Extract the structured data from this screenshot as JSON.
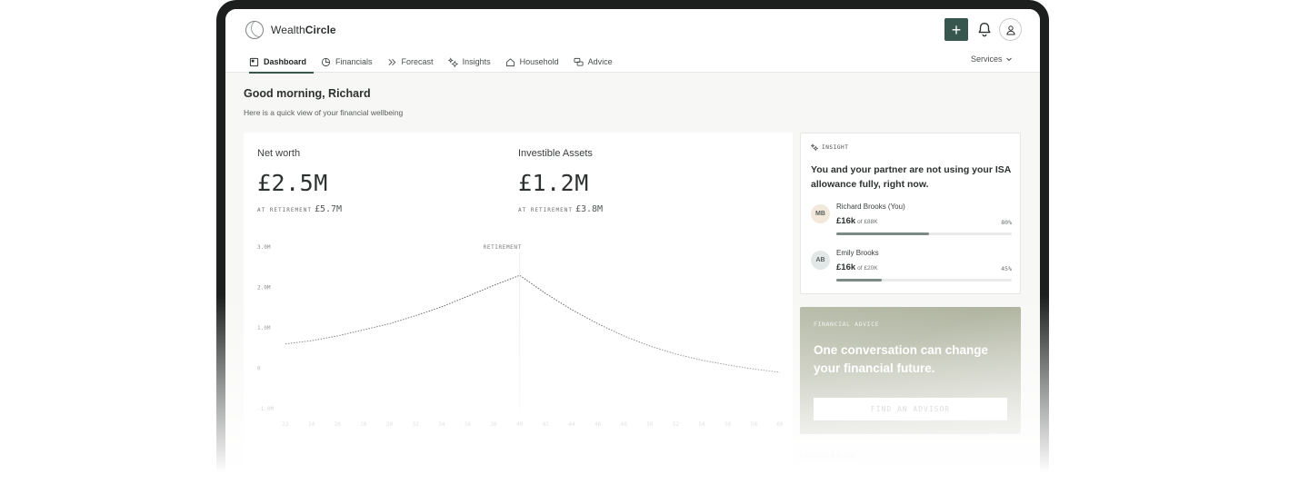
{
  "app": {
    "brand_prefix": "Wealth",
    "brand_suffix": "Circle"
  },
  "header": {
    "plus_label": "+",
    "services_label": "Services"
  },
  "nav": {
    "items": [
      {
        "label": "Dashboard",
        "icon": "dashboard-icon",
        "active": true
      },
      {
        "label": "Financials",
        "icon": "pie-chart-icon"
      },
      {
        "label": "Forecast",
        "icon": "chevrons-right-icon"
      },
      {
        "label": "Insights",
        "icon": "sparkle-icon"
      },
      {
        "label": "Household",
        "icon": "home-icon"
      },
      {
        "label": "Advice",
        "icon": "chat-icon"
      }
    ]
  },
  "greeting": {
    "title": "Good morning, Richard",
    "subtitle": "Here is a quick view of your financial wellbeing"
  },
  "metrics": {
    "net_worth": {
      "label": "Net worth",
      "value": "£2.5M",
      "ret_caption": "AT RETIREMENT",
      "ret_value": "£5.7M"
    },
    "investable": {
      "label": "Investible Assets",
      "value": "£1.2M",
      "ret_caption": "AT RETIREMENT",
      "ret_value": "£3.8M"
    }
  },
  "chart_data": {
    "type": "line",
    "ylabels": [
      "3.0M",
      "2.0M",
      "1.0M",
      "0",
      "-1.0M"
    ],
    "yvalues": [
      3.0,
      2.0,
      1.0,
      0,
      -1.0
    ],
    "ylim": [
      -1.0,
      3.0
    ],
    "x": [
      22,
      24,
      26,
      28,
      30,
      32,
      34,
      36,
      38,
      40,
      42,
      44,
      46,
      48,
      50,
      52,
      54,
      56,
      58,
      60
    ],
    "xtick_labels": [
      "22",
      "24",
      "26",
      "28",
      "30",
      "32",
      "34",
      "36",
      "38",
      "40",
      "42",
      "44",
      "46",
      "48",
      "50",
      "52",
      "54",
      "56",
      "58",
      "60"
    ],
    "annotation": "RETIREMENT",
    "series": [
      {
        "values": [
          0.6,
          0.68,
          0.8,
          0.95,
          1.1,
          1.3,
          1.52,
          1.78,
          2.05,
          2.3,
          1.85,
          1.45,
          1.1,
          0.8,
          0.55,
          0.35,
          0.2,
          0.08,
          -0.02,
          -0.1
        ]
      }
    ],
    "grid": false
  },
  "insight": {
    "tag": "INSIGHT",
    "title": "You and your partner are not using your ISA allowance fully, right now.",
    "people": [
      {
        "initials": "MB",
        "name": "Richard Brooks (You)",
        "amount": "£16k",
        "of": "of £88K",
        "pct_label": "80%",
        "fill": 0.53,
        "color": "#f2e9dc"
      },
      {
        "initials": "AB",
        "name": "Emily Brooks",
        "amount": "£16k",
        "of": "of £20K",
        "pct_label": "45%",
        "fill": 0.26,
        "color": "#e2e8e7"
      }
    ]
  },
  "advice": {
    "tag": "FINANCIAL ADVICE",
    "title": "One conversation can change your financial future.",
    "button": "FIND AN ADVISOR"
  },
  "learn_more": "Learn More"
}
